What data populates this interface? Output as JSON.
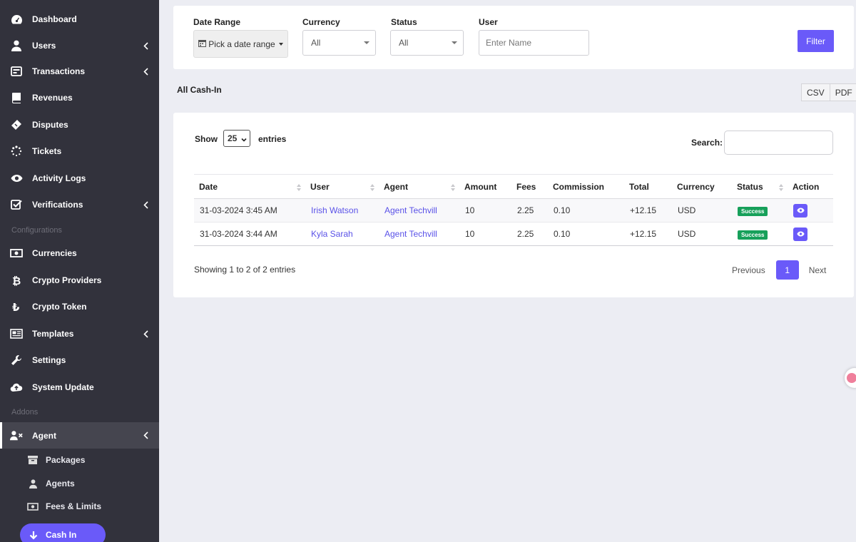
{
  "sidebar": {
    "items": [
      {
        "label": "Dashboard",
        "icon": "dashboard-icon",
        "has_children": false
      },
      {
        "label": "Users",
        "icon": "user-icon",
        "has_children": true
      },
      {
        "label": "Transactions",
        "icon": "transactions-icon",
        "has_children": true
      },
      {
        "label": "Revenues",
        "icon": "book-icon",
        "has_children": false
      },
      {
        "label": "Disputes",
        "icon": "ticket-icon",
        "has_children": false
      },
      {
        "label": "Tickets",
        "icon": "spinner-icon",
        "has_children": false
      },
      {
        "label": "Activity Logs",
        "icon": "eye-icon",
        "has_children": false
      },
      {
        "label": "Verifications",
        "icon": "check-square-icon",
        "has_children": true
      }
    ],
    "section_configurations": "Configurations",
    "config_items": [
      {
        "label": "Currencies",
        "icon": "money-bill-icon",
        "has_children": false
      },
      {
        "label": "Crypto Providers",
        "icon": "bitcoin-icon",
        "has_children": false
      },
      {
        "label": "Crypto Token",
        "icon": "lira-icon",
        "has_children": false
      },
      {
        "label": "Templates",
        "icon": "newspaper-icon",
        "has_children": true
      },
      {
        "label": "Settings",
        "icon": "wrench-icon",
        "has_children": false
      },
      {
        "label": "System Update",
        "icon": "cloud-upload-icon",
        "has_children": false
      }
    ],
    "section_addons": "Addons",
    "agent": {
      "label": "Agent",
      "icon": "user-times-icon"
    },
    "agent_sub": [
      {
        "label": "Packages",
        "icon": "archive-icon"
      },
      {
        "label": "Agents",
        "icon": "user-icon"
      },
      {
        "label": "Fees & Limits",
        "icon": "money-bill-icon"
      }
    ],
    "cash_in": {
      "label": "Cash In",
      "icon": "arrow-down-icon"
    }
  },
  "filters": {
    "date_range_label": "Date Range",
    "date_range_button": "Pick a date range",
    "currency_label": "Currency",
    "currency_value": "All",
    "status_label": "Status",
    "status_value": "All",
    "user_label": "User",
    "user_placeholder": "Enter Name",
    "filter_button": "Filter"
  },
  "page": {
    "title": "All Cash-In",
    "csv": "CSV",
    "pdf": "PDF"
  },
  "table": {
    "show_label": "Show",
    "page_length": "25",
    "entries_label": "entries",
    "search_label": "Search:",
    "columns": [
      "Date",
      "User",
      "Agent",
      "Amount",
      "Fees",
      "Commission",
      "Total",
      "Currency",
      "Status",
      "Action"
    ],
    "rows": [
      {
        "date": "31-03-2024 3:45 AM",
        "user": "Irish Watson",
        "agent": "Agent Techvill",
        "amount": "10",
        "fees": "2.25",
        "commission": "0.10",
        "total": "+12.15",
        "currency": "USD",
        "status": "Success"
      },
      {
        "date": "31-03-2024 3:44 AM",
        "user": "Kyla Sarah",
        "agent": "Agent Techvill",
        "amount": "10",
        "fees": "2.25",
        "commission": "0.10",
        "total": "+12.15",
        "currency": "USD",
        "status": "Success"
      }
    ],
    "info": "Showing 1 to 2 of 2 entries",
    "pagination": {
      "previous": "Previous",
      "current": "1",
      "next": "Next"
    }
  },
  "colors": {
    "sidebar_bg": "#32323c",
    "accent": "#6a5af9",
    "success": "#17a05a",
    "positive_text": "#1fa65a",
    "link": "#5a52e8",
    "page_bg": "#ecedf3"
  }
}
